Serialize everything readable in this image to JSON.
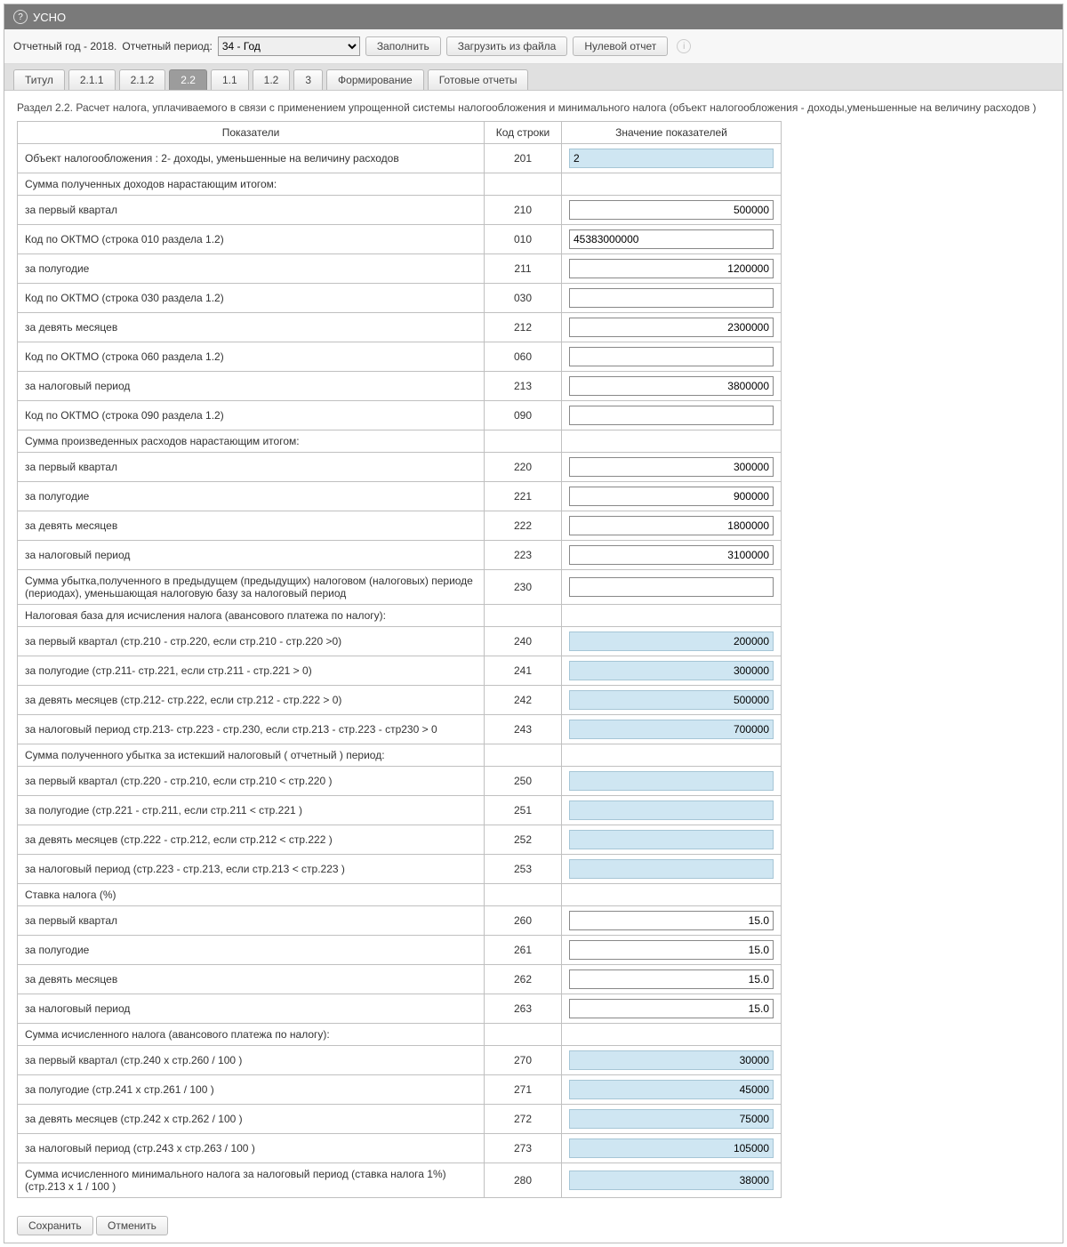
{
  "header": {
    "title": "УСНО"
  },
  "toolbar": {
    "year_label": "Отчетный год - 2018.",
    "period_label": "Отчетный период:",
    "period_value": "34 - Год",
    "fill": "Заполнить",
    "load": "Загрузить из файла",
    "zero": "Нулевой отчет"
  },
  "tabs": [
    {
      "id": "titul",
      "label": "Титул"
    },
    {
      "id": "s211",
      "label": "2.1.1"
    },
    {
      "id": "s212",
      "label": "2.1.2"
    },
    {
      "id": "s22",
      "label": "2.2",
      "active": true
    },
    {
      "id": "s11",
      "label": "1.1"
    },
    {
      "id": "s12",
      "label": "1.2"
    },
    {
      "id": "s3",
      "label": "3"
    },
    {
      "id": "form",
      "label": "Формирование"
    },
    {
      "id": "ready",
      "label": "Готовые отчеты"
    }
  ],
  "section_title": "Раздел 2.2. Расчет налога, уплачиваемого в связи с применением упрощенной системы налогообложения и минимального налога (объект налогообложения - доходы,уменьшенные на величину расходов )",
  "columns": {
    "ind": "Показатели",
    "code": "Код строки",
    "val": "Значение показателей"
  },
  "rows": [
    {
      "label": "Объект налогообложения : 2- доходы, уменьшенные на величину расходов",
      "code": "201",
      "value": "2",
      "readonly": true,
      "align": "left"
    },
    {
      "label": "Сумма полученных доходов нарастающим итогом:",
      "header": true
    },
    {
      "label": "за первый квартал",
      "code": "210",
      "value": "500000",
      "align": "right"
    },
    {
      "label": "Код по ОКТМО (строка 010 раздела 1.2)",
      "code": "010",
      "value": "45383000000",
      "align": "left"
    },
    {
      "label": "за полугодие",
      "code": "211",
      "value": "1200000",
      "align": "right"
    },
    {
      "label": "Код по ОКТМО (строка 030 раздела 1.2)",
      "code": "030",
      "value": "",
      "align": "left"
    },
    {
      "label": "за девять месяцев",
      "code": "212",
      "value": "2300000",
      "align": "right"
    },
    {
      "label": "Код по ОКТМО (строка 060 раздела 1.2)",
      "code": "060",
      "value": "",
      "align": "left"
    },
    {
      "label": "за налоговый период",
      "code": "213",
      "value": "3800000",
      "align": "right"
    },
    {
      "label": "Код по ОКТМО (строка 090 раздела 1.2)",
      "code": "090",
      "value": "",
      "align": "left"
    },
    {
      "label": "Сумма произведенных расходов нарастающим итогом:",
      "header": true
    },
    {
      "label": "за первый квартал",
      "code": "220",
      "value": "300000",
      "align": "right"
    },
    {
      "label": "за полугодие",
      "code": "221",
      "value": "900000",
      "align": "right"
    },
    {
      "label": "за девять месяцев",
      "code": "222",
      "value": "1800000",
      "align": "right"
    },
    {
      "label": "за налоговый период",
      "code": "223",
      "value": "3100000",
      "align": "right"
    },
    {
      "label": "Сумма убытка,полученного в предыдущем (предыдущих) налоговом (налоговых) периоде (периодах), уменьшающая налоговую базу за налоговый период",
      "code": "230",
      "value": "",
      "align": "right"
    },
    {
      "label": "Налоговая база для исчисления налога (авансового платежа по налогу):",
      "header": true
    },
    {
      "label": "за первый квартал (стр.210 - стр.220, если стр.210 - стр.220 >0)",
      "code": "240",
      "value": "200000",
      "readonly": true,
      "align": "right"
    },
    {
      "label": "за полугодие (стр.211- стр.221, если стр.211 - стр.221 > 0)",
      "code": "241",
      "value": "300000",
      "readonly": true,
      "align": "right"
    },
    {
      "label": "за девять месяцев (стр.212- стр.222, если стр.212 - стр.222 > 0)",
      "code": "242",
      "value": "500000",
      "readonly": true,
      "align": "right"
    },
    {
      "label": "за налоговый период стр.213- стр.223 - стр.230, если стр.213 - стр.223 - стр230 > 0",
      "code": "243",
      "value": "700000",
      "readonly": true,
      "align": "right"
    },
    {
      "label": "Сумма полученного убытка за истекший налоговый ( отчетный ) период:",
      "header": true
    },
    {
      "label": "за первый квартал (стр.220 - стр.210, если стр.210 < стр.220 )",
      "code": "250",
      "value": "",
      "readonly": true,
      "align": "right"
    },
    {
      "label": "за полугодие (стр.221 - стр.211, если стр.211 < стр.221 )",
      "code": "251",
      "value": "",
      "readonly": true,
      "align": "right"
    },
    {
      "label": "за девять месяцев (стр.222 - стр.212, если стр.212 < стр.222 )",
      "code": "252",
      "value": "",
      "readonly": true,
      "align": "right"
    },
    {
      "label": "за налоговый период (стр.223 - стр.213, если стр.213 < стр.223 )",
      "code": "253",
      "value": "",
      "readonly": true,
      "align": "right"
    },
    {
      "label": "Ставка налога (%)",
      "header": true
    },
    {
      "label": "за первый квартал",
      "code": "260",
      "value": "15.0",
      "align": "right"
    },
    {
      "label": "за полугодие",
      "code": "261",
      "value": "15.0",
      "align": "right"
    },
    {
      "label": "за девять месяцев",
      "code": "262",
      "value": "15.0",
      "align": "right"
    },
    {
      "label": "за налоговый период",
      "code": "263",
      "value": "15.0",
      "align": "right"
    },
    {
      "label": "Сумма исчисленного налога (авансового платежа по налогу):",
      "header": true
    },
    {
      "label": "за первый квартал (стр.240 х стр.260 / 100 )",
      "code": "270",
      "value": "30000",
      "readonly": true,
      "align": "right"
    },
    {
      "label": "за полугодие (стр.241 х стр.261 / 100 )",
      "code": "271",
      "value": "45000",
      "readonly": true,
      "align": "right"
    },
    {
      "label": "за девять месяцев (стр.242 х стр.262 / 100 )",
      "code": "272",
      "value": "75000",
      "readonly": true,
      "align": "right"
    },
    {
      "label": "за налоговый период (стр.243 х стр.263 / 100 )",
      "code": "273",
      "value": "105000",
      "readonly": true,
      "align": "right"
    },
    {
      "label": "Сумма исчисленного минимального налога за налоговый период (ставка налога 1%) (стр.213 х 1 / 100 )",
      "code": "280",
      "value": "38000",
      "readonly": true,
      "align": "right"
    }
  ],
  "footer": {
    "save": "Сохранить",
    "cancel": "Отменить"
  }
}
